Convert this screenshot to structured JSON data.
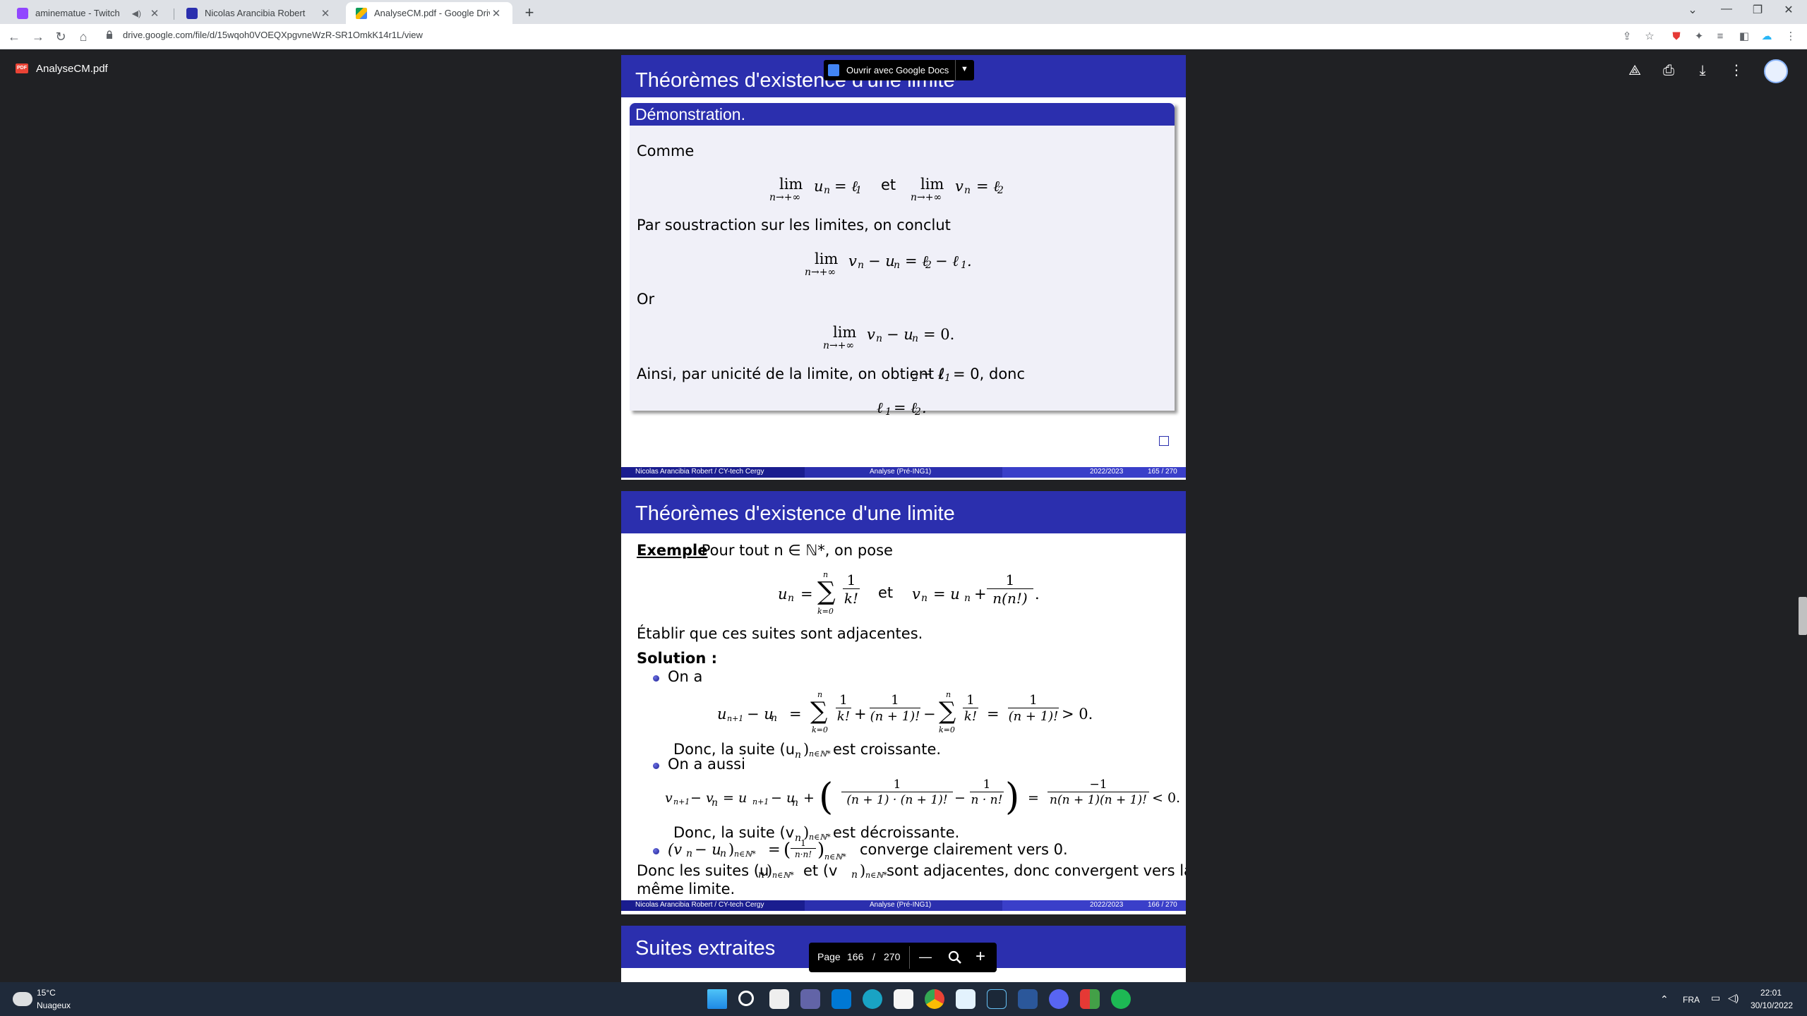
{
  "browser": {
    "tabs": [
      {
        "title": "aminematue - Twitch",
        "active": false
      },
      {
        "title": "Nicolas Arancibia Robert",
        "active": false
      },
      {
        "title": "AnalyseCM.pdf - Google Drive",
        "active": true
      }
    ],
    "url": "drive.google.com/file/d/15wqoh0VOEQXpgvneWzR-SR1OmkK14r1L/view"
  },
  "drive": {
    "file_name": "AnalyseCM.pdf",
    "open_with_label": "Ouvrir avec Google Docs",
    "pdf_badge": "PDF"
  },
  "slide165": {
    "frame_title": "Théorèmes d'existence d'une limite",
    "block_title": "Démonstration.",
    "lines": {
      "comme": "Comme",
      "eq1_lim": "lim",
      "eq1_sub": "n→+∞",
      "eq1_a": "u",
      "eq1_b": "= ℓ",
      "eq1_et": "et",
      "eq1_c": "v",
      "eq1_d": "= ℓ",
      "sub_n": "n",
      "sub_1": "1",
      "sub_2": "2",
      "par": "Par soustraction sur les limites, on conclut",
      "eq2": "v",
      "eq2_rest": "− u",
      "eq2_end": "= ℓ",
      "eq2_tail": "− ℓ",
      "eq2_dot": ".",
      "or": "Or",
      "eq3_end": "= 0.",
      "ainsi": "Ainsi, par unicité de la limite, on obtient ℓ",
      "ainsi2": "− ℓ",
      "ainsi3": "= 0, donc",
      "final_a": "ℓ",
      "final_b": "= ℓ",
      "final_c": "."
    },
    "footer": {
      "author": "Nicolas Arancibia Robert / CY-tech Cergy",
      "course": "Analyse (Pré-ING1)",
      "year": "2022/2023",
      "page": "165 / 270"
    }
  },
  "slide166": {
    "frame_title": "Théorèmes d'existence d'une limite",
    "exemple_label": "Exemple",
    "exemple_text": " : Pour tout n ∈ ℕ*, on pose",
    "def_un": "u",
    "def_eq": "=",
    "sum": "∑",
    "sum_top": "n",
    "sum_bot": "k=0",
    "one": "1",
    "kfact": "k!",
    "et": "et",
    "def_vn": "= u",
    "plus": "+",
    "nnf": "n(n!)",
    "dot": ".",
    "etablir": "Établir que ces suites sont adjacentes.",
    "solution": "Solution :",
    "b1": "On a",
    "b1_lhs": "u",
    "b1_sub1": "n+1",
    "b1_minus": "− u",
    "b1_eq": "=",
    "n1fact": "(n + 1)!",
    "minus": "−",
    "gt0": "> 0.",
    "donc1": "Donc, la suite (u",
    "donc1_sub": "n∈ℕ*",
    "donc1_end": "est croissante.",
    "b2": "On a aussi",
    "b2_lhs": "v",
    "b2_rest": "− v",
    "b2_eq": "= u",
    "b2_mid": "− u",
    "b2_plus": "+",
    "den_a": "(n + 1) · (n + 1)!",
    "den_b": "n · n!",
    "neg1": "−1",
    "den_c": "n(n + 1)(n + 1)!",
    "lt0": "< 0.",
    "donc2": "Donc, la suite (v",
    "donc2_end": "est décroissante.",
    "b3_a": "(v",
    "b3_b": "− u",
    "b3_c": "=",
    "b3_frac_num": "1",
    "b3_frac_den": "n·n!",
    "b3_end": "converge clairement vers 0.",
    "concl1": "Donc les suites (u",
    "concl1b": "et (v",
    "concl1c": "sont adjacentes, donc convergent vers la",
    "concl2": "même limite.",
    "footer": {
      "author": "Nicolas Arancibia Robert / CY-tech Cergy",
      "course": "Analyse (Pré-ING1)",
      "year": "2022/2023",
      "page": "166 / 270"
    }
  },
  "slide167": {
    "frame_title": "Suites extraites"
  },
  "pager": {
    "label": "Page",
    "current": "166",
    "sep": "/",
    "total": "270",
    "zoom_out": "—",
    "zoom_in": "+"
  },
  "taskbar": {
    "weather_temp": "15°C",
    "weather_desc": "Nuageux",
    "lang": "FRA",
    "time": "22:01",
    "date": "30/10/2022"
  }
}
